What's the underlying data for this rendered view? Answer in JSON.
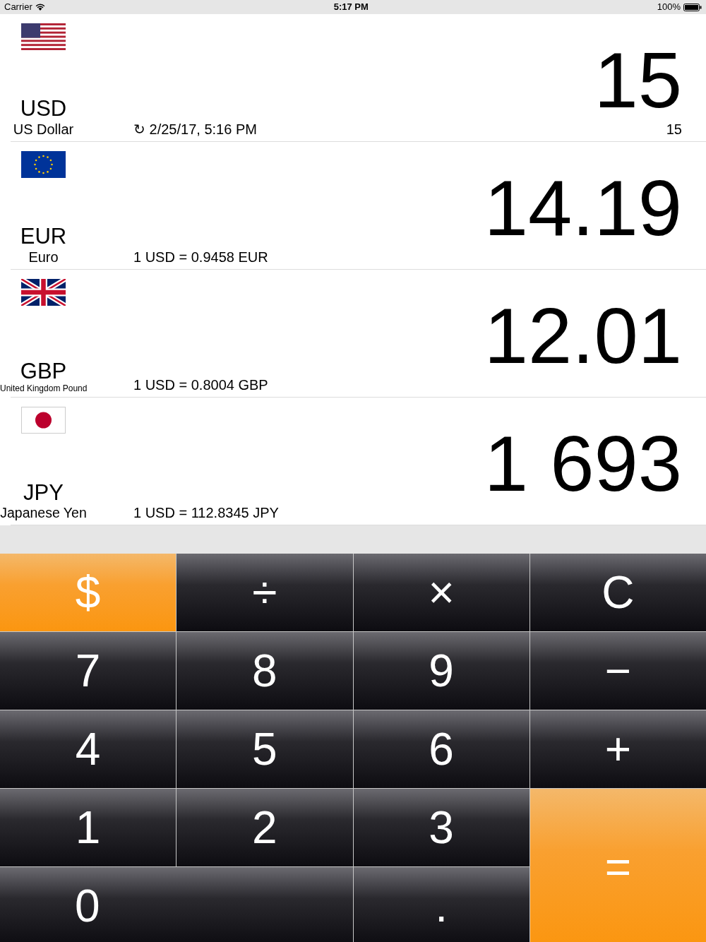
{
  "status_bar": {
    "carrier": "Carrier",
    "time": "5:17 PM",
    "battery": "100%"
  },
  "currencies": [
    {
      "code": "USD",
      "name": "US Dollar",
      "info": "↻ 2/25/17, 5:16 PM",
      "amount": "15",
      "input": "15"
    },
    {
      "code": "EUR",
      "name": "Euro",
      "info": "1 USD = 0.9458 EUR",
      "amount": "14.19"
    },
    {
      "code": "GBP",
      "name": "United Kingdom Pound",
      "info": "1 USD = 0.8004 GBP",
      "amount": "12.01"
    },
    {
      "code": "JPY",
      "name": "Japanese Yen",
      "info": "1 USD = 112.8345 JPY",
      "amount": "1 693"
    }
  ],
  "keys": [
    {
      "label": "$",
      "kind": "accent"
    },
    {
      "label": "÷",
      "kind": "dark"
    },
    {
      "label": "×",
      "kind": "dark"
    },
    {
      "label": "C",
      "kind": "dark"
    },
    {
      "label": "7",
      "kind": "dark"
    },
    {
      "label": "8",
      "kind": "dark"
    },
    {
      "label": "9",
      "kind": "dark"
    },
    {
      "label": "−",
      "kind": "dark"
    },
    {
      "label": "4",
      "kind": "dark"
    },
    {
      "label": "5",
      "kind": "dark"
    },
    {
      "label": "6",
      "kind": "dark"
    },
    {
      "label": "+",
      "kind": "dark"
    },
    {
      "label": "1",
      "kind": "dark"
    },
    {
      "label": "2",
      "kind": "dark"
    },
    {
      "label": "3",
      "kind": "dark"
    },
    {
      "label": "=",
      "kind": "tall"
    },
    {
      "label": "0",
      "kind": "wide"
    },
    {
      "label": ".",
      "kind": "dark"
    }
  ]
}
